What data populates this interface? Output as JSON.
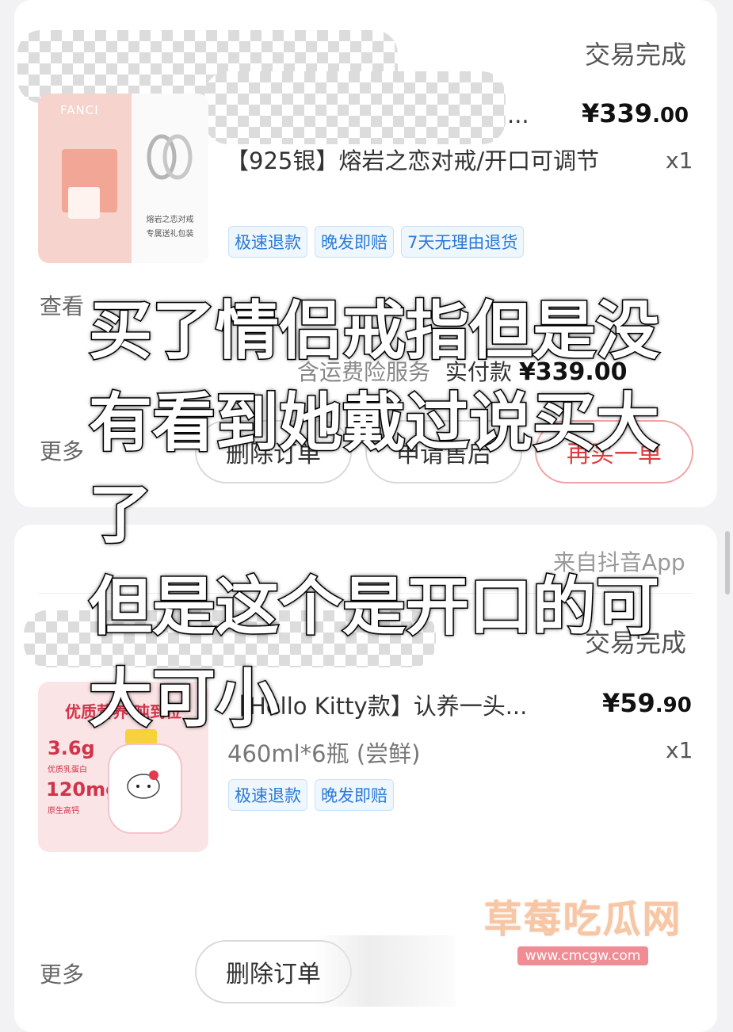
{
  "orders": [
    {
      "status": "交易完成",
      "product_title_truncated": "...",
      "product_title": "【925银】熔岩之恋对戒/开口可调节",
      "price_main": "¥339",
      "price_decimal": ".00",
      "quantity": "x1",
      "tags": [
        "极速退款",
        "晚发即赔",
        "7天无理由退货"
      ],
      "logistics_link": "查看",
      "service_note": "含运费险服务",
      "paid_label": "实付款",
      "paid_amount": "¥339.00",
      "more": "更多",
      "buttons": [
        "删除订单",
        "申请售后",
        "再买一单"
      ],
      "thumbnail": {
        "brand": "FANCI",
        "caption_line1": "熔岩之恋对戒",
        "caption_line2": "专属送礼包装"
      }
    },
    {
      "source": "来自抖音App",
      "status": "交易完成",
      "product_title": "【Hello Kitty款】认养一头...",
      "product_spec": "460ml*6瓶 (尝鲜)",
      "price_main": "¥59",
      "price_decimal": ".90",
      "quantity": "x1",
      "tags": [
        "极速退款",
        "晚发即赔"
      ],
      "more": "更多",
      "buttons": [
        "删除订单"
      ],
      "thumbnail": {
        "headline": "优质营养 吨到位",
        "stat1": "3.6g",
        "stat1_label": "优质乳蛋白",
        "stat2": "120mg",
        "stat2_label": "原生高钙"
      }
    }
  ],
  "overlay_caption": [
    "买了情侣戒指但是没",
    "有看到她戴过说买大",
    "了",
    "但是这个是开口的可",
    "大可小"
  ],
  "watermark": {
    "name": "草莓吃瓜网",
    "url": "www.cmcgw.com"
  },
  "colors": {
    "tag_blue": "#2a7ad6",
    "rebuy_red": "#e33b3b",
    "page_bg": "#f2f2f4"
  }
}
